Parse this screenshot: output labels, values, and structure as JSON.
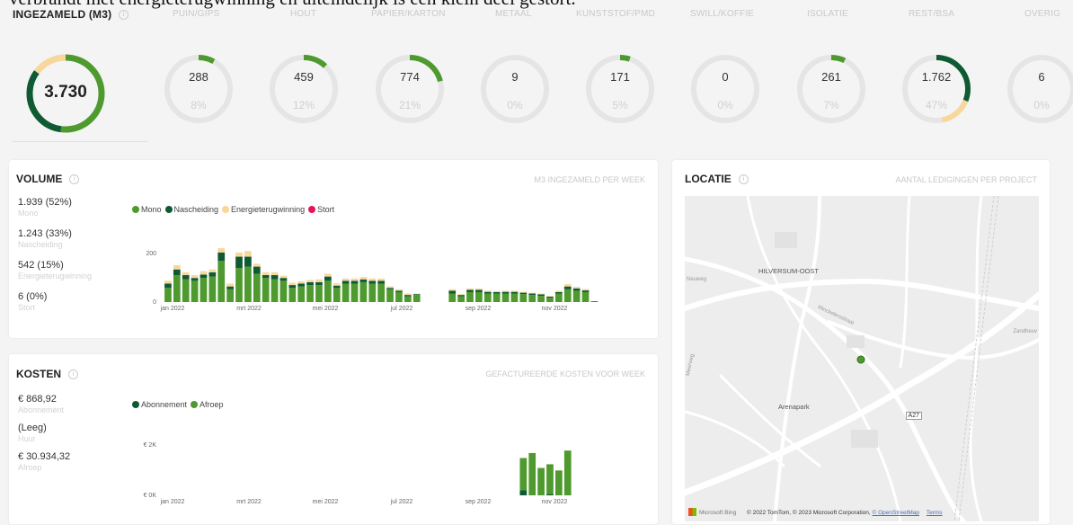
{
  "top_text": "verbrandt met energieterugwinning en uiteindelijk is een klein deel gestort.",
  "summary": {
    "title": "INGEZAMELD (M3)",
    "info_icon": "info-icon",
    "total": "3.730",
    "total_segments": [
      {
        "label": "Mono",
        "fraction": 0.52,
        "color": "#4e9a2e"
      },
      {
        "label": "Nascheiding",
        "fraction": 0.33,
        "color": "#0d5a33"
      },
      {
        "label": "Energieterugwinning",
        "fraction": 0.15,
        "color": "#f7d79a"
      }
    ],
    "categories": [
      {
        "name": "PUIN/GIPS",
        "value": "288",
        "pct": "8%",
        "fraction": 0.08
      },
      {
        "name": "HOUT",
        "value": "459",
        "pct": "12%",
        "fraction": 0.12
      },
      {
        "name": "PAPIER/KARTON",
        "value": "774",
        "pct": "21%",
        "fraction": 0.21
      },
      {
        "name": "METAAL",
        "value": "9",
        "pct": "0%",
        "fraction": 0.0
      },
      {
        "name": "KUNSTSTOF/PMD",
        "value": "171",
        "pct": "5%",
        "fraction": 0.05
      },
      {
        "name": "SWILL/KOFFIE",
        "value": "0",
        "pct": "0%",
        "fraction": 0.0
      },
      {
        "name": "ISOLATIE",
        "value": "261",
        "pct": "7%",
        "fraction": 0.07
      },
      {
        "name": "REST/BSA",
        "value": "1.762",
        "pct": "47%",
        "fraction": 0.47
      },
      {
        "name": "OVERIG",
        "value": "6",
        "pct": "0%",
        "fraction": 0.0
      }
    ]
  },
  "volume": {
    "title": "VOLUME",
    "subtitle": "M3 INGEZAMELD PER WEEK",
    "stats": [
      {
        "value": "1.939 (52%)",
        "label": "Mono"
      },
      {
        "value": "1.243 (33%)",
        "label": "Nascheiding"
      },
      {
        "value": "542 (15%)",
        "label": "Energieterugwinning"
      },
      {
        "value": "6 (0%)",
        "label": "Stort"
      }
    ],
    "legend": [
      {
        "label": "Mono",
        "color": "#4e9a2e"
      },
      {
        "label": "Nascheiding",
        "color": "#0d5a33"
      },
      {
        "label": "Energieterugwinning",
        "color": "#f7d79a"
      },
      {
        "label": "Stort",
        "color": "#e3165b"
      }
    ]
  },
  "kosten": {
    "title": "KOSTEN",
    "subtitle": "GEFACTUREERDE KOSTEN VOOR WEEK",
    "stats": [
      {
        "value": "€ 868,92",
        "label": "Abonnement"
      },
      {
        "value": "(Leeg)",
        "label": "Huur"
      },
      {
        "value": "€ 30.934,32",
        "label": "Afroep"
      }
    ],
    "legend": [
      {
        "label": "Abonnement",
        "color": "#0d5a33"
      },
      {
        "label": "Afroep",
        "color": "#4e9a2e"
      }
    ]
  },
  "locatie": {
    "title": "LOCATIE",
    "subtitle": "AANTAL LEDIGINGEN PER PROJECT",
    "labels": {
      "hilversum": "HILVERSUM-OOST",
      "arenapark": "Arenapark",
      "road": "A27",
      "zandheuv": "Zandheuv",
      "street1": "Minckelersstraat",
      "street2": "Neuweg",
      "street3": "Meerweg"
    },
    "footer": {
      "bing": "Microsoft Bing",
      "copy": "© 2022 TomTom, © 2023 Microsoft Corporation,",
      "osm": "© OpenStreetMap",
      "terms": "Terms"
    }
  },
  "chart_data": [
    {
      "type": "bar",
      "title": "M3 INGEZAMELD PER WEEK",
      "stacked": true,
      "x_tick_labels": [
        "jan 2022",
        "mrt 2022",
        "mei 2022",
        "jul 2022",
        "sep 2022",
        "nov 2022"
      ],
      "y_tick_labels": [
        "0",
        "200"
      ],
      "ylim": [
        0,
        260
      ],
      "categories": [
        "w1",
        "w2",
        "w3",
        "w4",
        "w5",
        "w6",
        "w7",
        "w8",
        "w9",
        "w10",
        "w11",
        "w12",
        "w13",
        "w14",
        "w15",
        "w16",
        "w17",
        "w18",
        "w19",
        "w20",
        "w21",
        "w22",
        "w23",
        "w24",
        "w25",
        "w26",
        "w27",
        "w28",
        "w29",
        "w30",
        "w31",
        "w32",
        "w33",
        "w34",
        "w35",
        "w36",
        "w37",
        "w38",
        "w39",
        "w40",
        "w41",
        "w42",
        "w43",
        "w44",
        "w45",
        "w46",
        "w47",
        "w48",
        "w49",
        "w50",
        "w51",
        "w52"
      ],
      "series": [
        {
          "name": "Mono",
          "values": [
            50,
            95,
            80,
            75,
            85,
            90,
            145,
            45,
            120,
            125,
            100,
            85,
            80,
            75,
            50,
            55,
            60,
            60,
            75,
            50,
            65,
            65,
            70,
            65,
            65,
            45,
            35,
            20,
            25,
            0,
            0,
            0,
            30,
            20,
            35,
            35,
            30,
            30,
            30,
            30,
            28,
            25,
            22,
            15,
            30,
            45,
            40,
            35,
            0,
            0,
            0,
            0
          ]
        },
        {
          "name": "Nascheiding",
          "values": [
            15,
            20,
            15,
            10,
            12,
            15,
            30,
            10,
            40,
            35,
            25,
            10,
            15,
            10,
            10,
            10,
            10,
            10,
            15,
            8,
            10,
            10,
            10,
            10,
            10,
            5,
            5,
            5,
            3,
            0,
            0,
            0,
            10,
            5,
            8,
            8,
            6,
            5,
            6,
            6,
            5,
            5,
            5,
            4,
            5,
            10,
            8,
            6,
            0,
            0,
            0,
            0
          ]
        },
        {
          "name": "Energieterugwinning",
          "values": [
            10,
            15,
            10,
            10,
            12,
            10,
            15,
            10,
            15,
            20,
            10,
            10,
            10,
            8,
            8,
            8,
            8,
            10,
            10,
            8,
            8,
            8,
            8,
            8,
            8,
            5,
            5,
            5,
            2,
            0,
            0,
            0,
            5,
            3,
            5,
            5,
            4,
            4,
            4,
            4,
            3,
            3,
            3,
            2,
            5,
            8,
            6,
            5,
            0,
            0,
            0,
            0
          ]
        },
        {
          "name": "Stort",
          "values": [
            0,
            0,
            0,
            0,
            0,
            0,
            0,
            0,
            0,
            0,
            0,
            0,
            0,
            0,
            0,
            0,
            0,
            0,
            0,
            0,
            0,
            0,
            0,
            0,
            0,
            0,
            0,
            0,
            0,
            0,
            0,
            0,
            0,
            0,
            0,
            0,
            0,
            0,
            0,
            0,
            0,
            0,
            0,
            0,
            0,
            0,
            0,
            0,
            3,
            0,
            0,
            0
          ]
        }
      ]
    },
    {
      "type": "bar",
      "title": "GEFACTUREERDE KOSTEN VOOR WEEK",
      "stacked": true,
      "x_tick_labels": [
        "jan 2022",
        "mrt 2022",
        "mei 2022",
        "jul 2022",
        "sep 2022",
        "nov 2022"
      ],
      "y_tick_labels": [
        "€ 0K",
        "€ 2K"
      ],
      "ylim": [
        0,
        3000
      ],
      "categories": [
        "w1",
        "w2",
        "w3",
        "w4",
        "w5",
        "w6",
        "w7",
        "w8",
        "w9",
        "w10",
        "w11",
        "w12",
        "w13",
        "w14",
        "w15",
        "w16",
        "w17",
        "w18",
        "w19",
        "w20",
        "w21",
        "w22",
        "w23",
        "w24",
        "w25",
        "w26",
        "w27",
        "w28",
        "w29",
        "w30",
        "w31",
        "w32",
        "w33",
        "w34",
        "w35",
        "w36",
        "w37",
        "w38",
        "w39",
        "w40",
        "w41",
        "w42",
        "w43",
        "w44",
        "w45",
        "w46",
        "w47",
        "w48",
        "w49",
        "w50",
        "w51",
        "w52"
      ],
      "series": [
        {
          "name": "Abonnement",
          "values": [
            0,
            0,
            0,
            0,
            0,
            0,
            0,
            0,
            0,
            0,
            0,
            0,
            0,
            0,
            0,
            0,
            0,
            0,
            0,
            0,
            0,
            0,
            0,
            0,
            0,
            0,
            0,
            0,
            0,
            0,
            0,
            0,
            0,
            0,
            0,
            0,
            0,
            0,
            0,
            0,
            200,
            0,
            0,
            50,
            0,
            0,
            0,
            0,
            0,
            0,
            0,
            0
          ]
        },
        {
          "name": "Afroep",
          "values": [
            0,
            0,
            0,
            0,
            0,
            0,
            0,
            0,
            0,
            0,
            0,
            0,
            0,
            0,
            0,
            0,
            0,
            0,
            0,
            0,
            0,
            0,
            0,
            0,
            0,
            0,
            0,
            0,
            0,
            0,
            0,
            0,
            0,
            0,
            0,
            0,
            0,
            0,
            0,
            0,
            1300,
            1700,
            1100,
            1200,
            1000,
            1800,
            0,
            0,
            0,
            0,
            0,
            0
          ]
        }
      ]
    }
  ]
}
